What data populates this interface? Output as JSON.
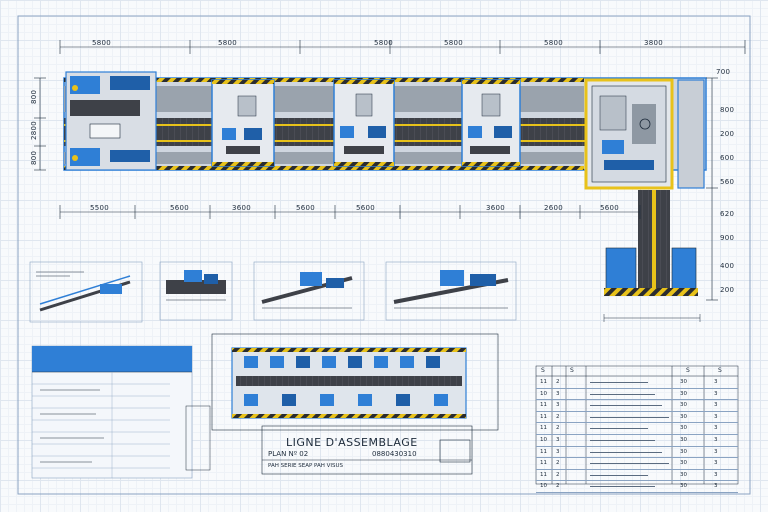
{
  "drawing": {
    "title": "LIGNE D'ASSEMBLAGE",
    "plan_no": "PLAN Nº 02",
    "subtitle": "PAH SERIE SEAP PAH VISUS",
    "drawing_code": "0880430310"
  },
  "dimensions": {
    "top": [
      "5800",
      "5800",
      "5800",
      "5800",
      "5800",
      "3800"
    ],
    "bottom": [
      "5500",
      "5600",
      "3600",
      "5600",
      "5600",
      "3600",
      "2600",
      "5600"
    ],
    "right": [
      "700",
      "800",
      "200",
      "600",
      "560",
      "620",
      "900",
      "400",
      "200"
    ],
    "left": [
      "800",
      "2800",
      "800"
    ]
  },
  "spec_table": {
    "header": [
      "S",
      "S",
      "",
      "S",
      "S"
    ],
    "rows": [
      [
        "11",
        "2",
        "30",
        "3"
      ],
      [
        "10",
        "3",
        "30",
        "3"
      ],
      [
        "11",
        "3",
        "30",
        "3"
      ],
      [
        "11",
        "2",
        "30",
        "3"
      ],
      [
        "11",
        "2",
        "30",
        "3"
      ],
      [
        "10",
        "3",
        "30",
        "3"
      ],
      [
        "11",
        "3",
        "30",
        "3"
      ],
      [
        "11",
        "2",
        "30",
        "3"
      ],
      [
        "11",
        "2",
        "30",
        "3"
      ],
      [
        "10",
        "2",
        "30",
        "3"
      ]
    ]
  },
  "colors": {
    "accent": "#2f7fd6",
    "conveyor": "#3e4148",
    "hazard": "#e8c21a",
    "line": "#1c2a3a"
  }
}
